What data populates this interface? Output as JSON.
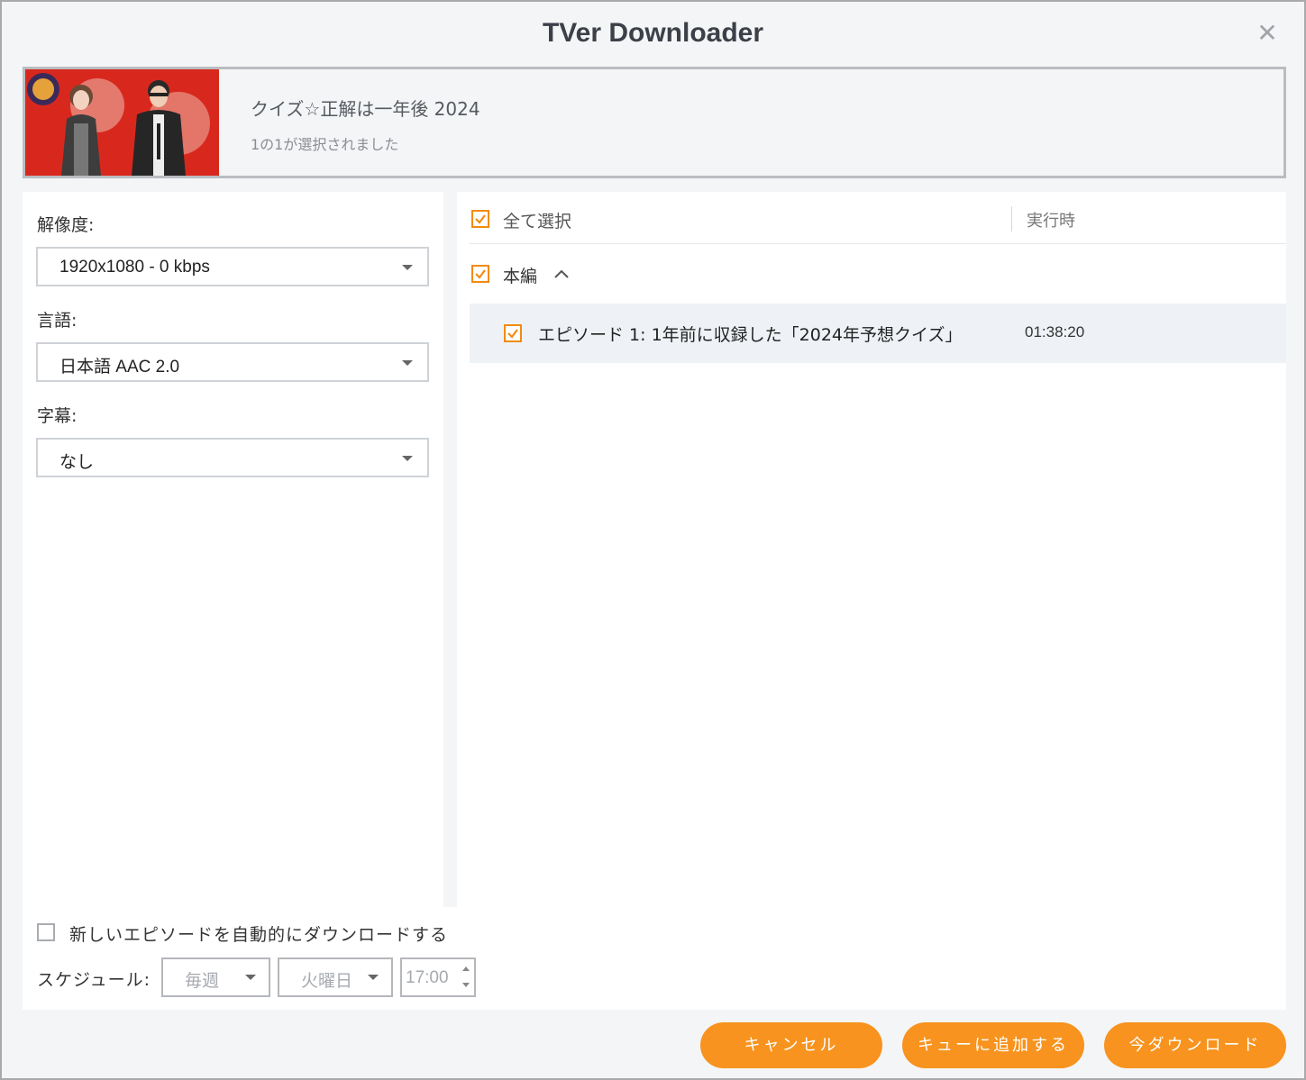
{
  "window": {
    "title": "TVer Downloader"
  },
  "header": {
    "title": "クイズ☆正解は一年後 2024",
    "subtitle": "1の1が選択されました"
  },
  "settings": {
    "resolution_label": "解像度:",
    "resolution_value": "1920x1080 - 0 kbps",
    "language_label": "言語:",
    "language_value": "日本語 AAC 2.0",
    "subtitle_label": "字幕:",
    "subtitle_value": "なし"
  },
  "list": {
    "select_all_label": "全て選択",
    "column_runtime": "実行時",
    "group_label": "本編",
    "episodes": [
      {
        "title": "エピソード 1: 1年前に収録した「2024年予想クイズ」",
        "duration": "01:38:20",
        "checked": true
      }
    ]
  },
  "schedule": {
    "auto_download_label": "新しいエピソードを自動的にダウンロードする",
    "auto_download_checked": false,
    "schedule_label": "スケジュール:",
    "frequency": "毎週",
    "day": "火曜日",
    "time": "17:00"
  },
  "buttons": {
    "cancel": "キャンセル",
    "add_to_queue": "キューに追加する",
    "download_now": "今ダウンロード"
  },
  "colors": {
    "accent": "#f7931e",
    "checkbox": "#f28b13"
  }
}
